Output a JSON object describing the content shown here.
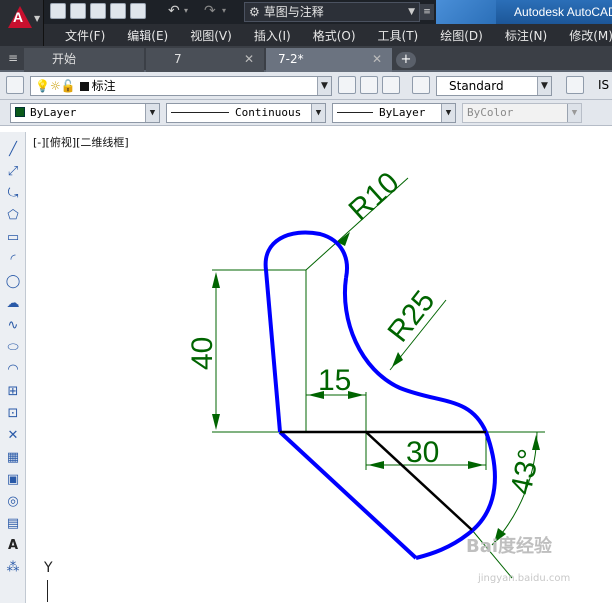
{
  "titlebar": {
    "app_title": "Autodesk AutoCAD",
    "workspace": "草图与注释"
  },
  "menu": {
    "items": [
      "文件(F)",
      "编辑(E)",
      "视图(V)",
      "插入(I)",
      "格式(O)",
      "工具(T)",
      "绘图(D)",
      "标注(N)",
      "修改(M)"
    ]
  },
  "tabs": [
    {
      "label": "开始",
      "active": false
    },
    {
      "label": "7",
      "active": false
    },
    {
      "label": "7-2*",
      "active": true
    }
  ],
  "layer_toolbar": {
    "layer_name": "标注",
    "dim_style": "Standard",
    "iso_truncated": "IS"
  },
  "properties": {
    "color": "ByLayer",
    "linetype": "Continuous",
    "lineweight": "ByLayer",
    "plotstyle": "ByColor"
  },
  "viewport": {
    "label": "[-][俯视][二维线框]"
  },
  "drawing": {
    "dimensions": {
      "r10": "R10",
      "r25": "R25",
      "d40": "40",
      "d15": "15",
      "d30": "30",
      "a43": "43°"
    },
    "colors": {
      "outline": "#0000ff",
      "dimension": "#006400",
      "centerline": "#000000"
    }
  },
  "ucs": {
    "y_label": "Y"
  },
  "watermark": {
    "text": "Bai度经验",
    "url_text": "jingyan.baidu.com"
  }
}
